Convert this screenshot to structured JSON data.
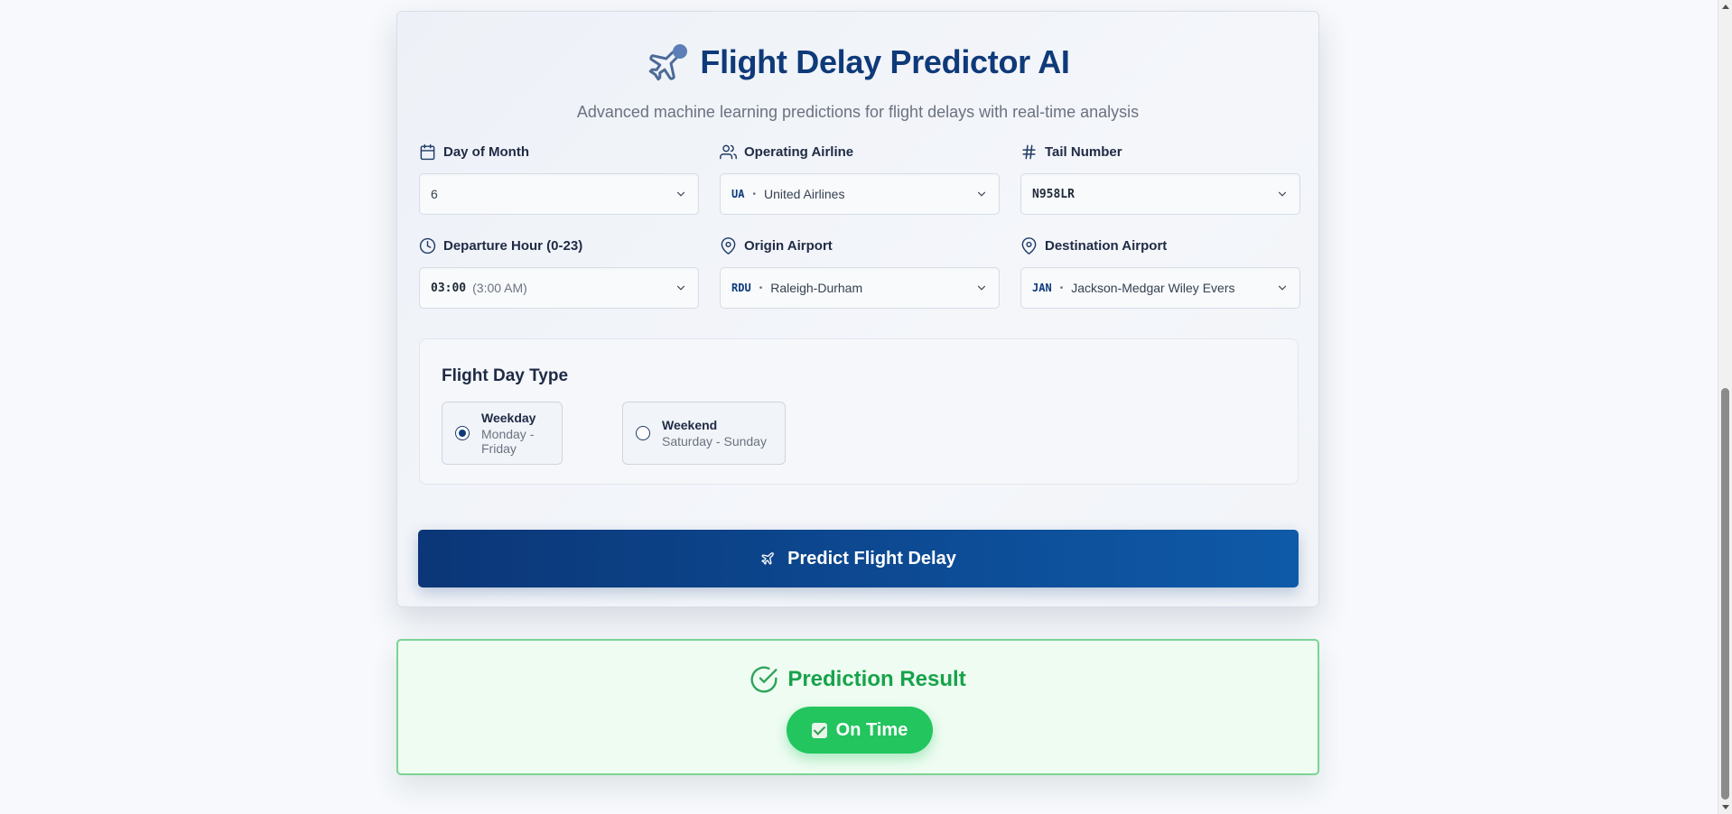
{
  "header": {
    "title": "Flight Delay Predictor AI",
    "subtitle": "Advanced machine learning predictions for flight delays with real-time analysis",
    "icon": "plane-icon"
  },
  "form": {
    "day_of_month": {
      "label": "Day of Month",
      "icon": "calendar-icon",
      "value": "6"
    },
    "operating_airline": {
      "label": "Operating Airline",
      "icon": "users-icon",
      "code": "UA",
      "separator": "•",
      "name": "United Airlines"
    },
    "tail_number": {
      "label": "Tail Number",
      "icon": "hash-icon",
      "value": "N958LR"
    },
    "departure_hour": {
      "label": "Departure Hour (0-23)",
      "icon": "clock-icon",
      "value": "03:00",
      "hint": "(3:00 AM)"
    },
    "origin_airport": {
      "label": "Origin Airport",
      "icon": "map-pin-icon",
      "code": "RDU",
      "separator": "•",
      "name": "Raleigh-Durham"
    },
    "destination_airport": {
      "label": "Destination Airport",
      "icon": "map-pin-icon",
      "code": "JAN",
      "separator": "•",
      "name": "Jackson-Medgar Wiley Evers"
    }
  },
  "day_type": {
    "title": "Flight Day Type",
    "options": [
      {
        "label": "Weekday",
        "sub": "Monday - Friday",
        "selected": true
      },
      {
        "label": "Weekend",
        "sub": "Saturday - Sunday",
        "selected": false
      }
    ]
  },
  "predict_button": {
    "label": "Predict Flight Delay",
    "icon": "plane-icon"
  },
  "result": {
    "title": "Prediction Result",
    "icon": "check-circle-icon",
    "status": "On Time",
    "status_icon": "check-box-icon"
  },
  "colors": {
    "primary": "#0f3a7a",
    "success": "#22c55e",
    "success_text": "#16a34a",
    "muted_text": "#6b7280"
  }
}
